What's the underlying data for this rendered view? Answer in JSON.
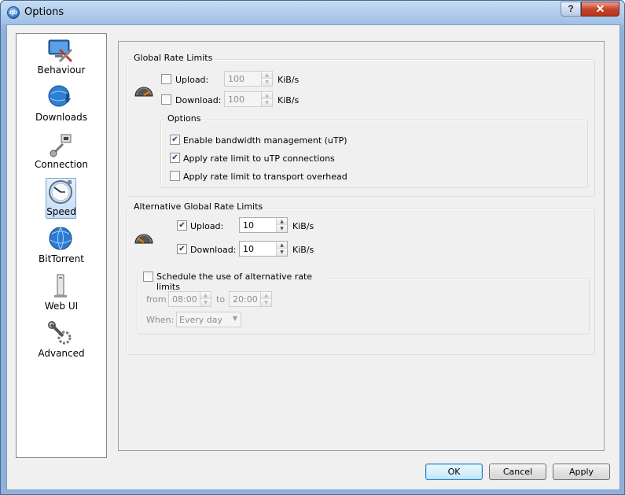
{
  "window": {
    "title": "Options",
    "help_label": "?",
    "close_label": "✕"
  },
  "sidebar": {
    "items": [
      {
        "label": "Behaviour",
        "icon": "monitor-tools-icon"
      },
      {
        "label": "Downloads",
        "icon": "globe-download-icon"
      },
      {
        "label": "Connection",
        "icon": "network-plug-icon"
      },
      {
        "label": "Speed",
        "icon": "clock-speed-icon",
        "selected": true
      },
      {
        "label": "BitTorrent",
        "icon": "globe-icon"
      },
      {
        "label": "Web UI",
        "icon": "server-tower-icon"
      },
      {
        "label": "Advanced",
        "icon": "wrench-gear-icon"
      }
    ]
  },
  "global": {
    "title": "Global Rate Limits",
    "upload": {
      "label": "Upload:",
      "checked": false,
      "value": "100",
      "unit": "KiB/s"
    },
    "download": {
      "label": "Download:",
      "checked": false,
      "value": "100",
      "unit": "KiB/s"
    },
    "options": {
      "title": "Options",
      "utp": {
        "label": "Enable bandwidth management (uTP)",
        "checked": true
      },
      "utp_limit": {
        "label": "Apply rate limit to uTP connections",
        "checked": true
      },
      "overhead": {
        "label": "Apply rate limit to transport overhead",
        "checked": false
      }
    }
  },
  "alt": {
    "title": "Alternative Global Rate Limits",
    "upload": {
      "label": "Upload:",
      "checked": true,
      "value": "10",
      "unit": "KiB/s"
    },
    "download": {
      "label": "Download:",
      "checked": true,
      "value": "10",
      "unit": "KiB/s"
    },
    "schedule": {
      "label": "Schedule the use of alternative rate limits",
      "checked": false,
      "from_label": "from",
      "from_value": "08:00",
      "to_label": "to",
      "to_value": "20:00",
      "when_label": "When:",
      "when_value": "Every day"
    }
  },
  "buttons": {
    "ok": "OK",
    "cancel": "Cancel",
    "apply": "Apply"
  }
}
